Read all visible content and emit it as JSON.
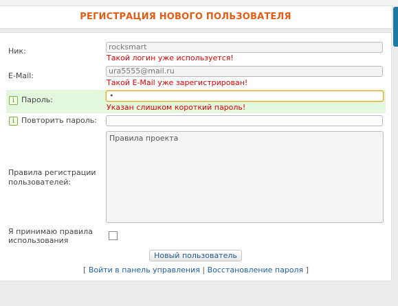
{
  "title": "РЕГИСТРАЦИЯ НОВОГО ПОЛЬЗОВАТЕЛЯ",
  "form": {
    "nick": {
      "label": "Ник:",
      "value": "rocksmart",
      "error": "Такой логин уже используется!"
    },
    "email": {
      "label": "E-Mail:",
      "value": "ura5555@mail.ru",
      "error": "Такой E-Mail уже зарегистрирован!"
    },
    "password": {
      "label": "Пароль:",
      "value": "•",
      "error": "Указан слишком короткий пароль!"
    },
    "password_repeat": {
      "label": "Повторить пароль:",
      "value": ""
    },
    "rules": {
      "label_line1": "Правила регистрации",
      "label_line2": "пользователей:",
      "text": "Правила проекта"
    },
    "accept": {
      "label_line1": "Я принимаю правила",
      "label_line2": "использования",
      "checked": false
    },
    "submit_label": "Новый пользователь"
  },
  "links": {
    "open_bracket": "[",
    "login": "Войти в панель управления",
    "separator": "|",
    "restore": "Восстановление пароля",
    "close_bracket": "]"
  },
  "icons": {
    "info": "i"
  },
  "colors": {
    "title": "#e35c14",
    "error": "#dd0000",
    "highlight": "#e3f7df",
    "link": "#1d5fa0"
  }
}
